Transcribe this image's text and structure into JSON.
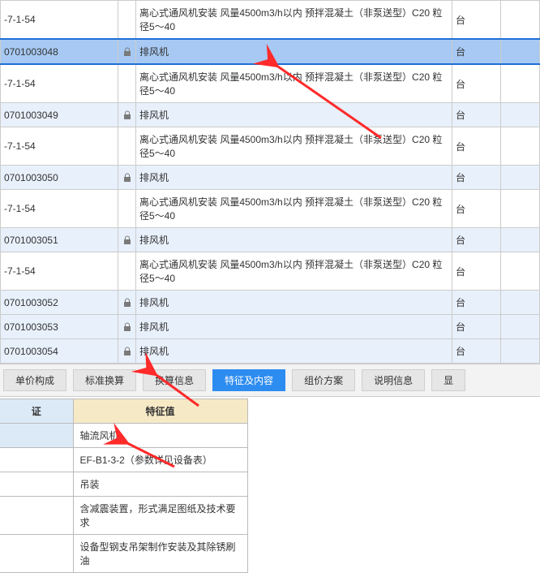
{
  "grid": {
    "rows": [
      {
        "code": "-7-1-54",
        "lock": false,
        "desc": "离心式通风机安装 风量4500m3/h以内 预拌混凝土（非泵送型）C20 粒径5～40",
        "unit": "台",
        "style": "white",
        "tall": true
      },
      {
        "code": "0701003048",
        "lock": true,
        "desc": "排风机",
        "unit": "台",
        "style": "selected"
      },
      {
        "code": "-7-1-54",
        "lock": false,
        "desc": "离心式通风机安装 风量4500m3/h以内 预拌混凝土（非泵送型）C20 粒径5～40",
        "unit": "台",
        "style": "white",
        "tall": true
      },
      {
        "code": "0701003049",
        "lock": true,
        "desc": "排风机",
        "unit": "台",
        "style": "blue"
      },
      {
        "code": "-7-1-54",
        "lock": false,
        "desc": "离心式通风机安装 风量4500m3/h以内 预拌混凝土（非泵送型）C20 粒径5～40",
        "unit": "台",
        "style": "white",
        "tall": true
      },
      {
        "code": "0701003050",
        "lock": true,
        "desc": "排风机",
        "unit": "台",
        "style": "blue"
      },
      {
        "code": "-7-1-54",
        "lock": false,
        "desc": "离心式通风机安装 风量4500m3/h以内 预拌混凝土（非泵送型）C20 粒径5～40",
        "unit": "台",
        "style": "white",
        "tall": true
      },
      {
        "code": "0701003051",
        "lock": true,
        "desc": "排风机",
        "unit": "台",
        "style": "blue"
      },
      {
        "code": "-7-1-54",
        "lock": false,
        "desc": "离心式通风机安装 风量4500m3/h以内 预拌混凝土（非泵送型）C20 粒径5～40",
        "unit": "台",
        "style": "white",
        "tall": true
      },
      {
        "code": "0701003052",
        "lock": true,
        "desc": "排风机",
        "unit": "台",
        "style": "blue"
      },
      {
        "code": "0701003053",
        "lock": true,
        "desc": "排风机",
        "unit": "台",
        "style": "blue"
      },
      {
        "code": "0701003054",
        "lock": true,
        "desc": "排风机",
        "unit": "台",
        "style": "blue"
      }
    ]
  },
  "tabs": {
    "items": [
      {
        "label": "单价构成",
        "active": false
      },
      {
        "label": "标准换算",
        "active": false
      },
      {
        "label": "换算信息",
        "active": false
      },
      {
        "label": "特征及内容",
        "active": true
      },
      {
        "label": "组价方案",
        "active": false
      },
      {
        "label": "说明信息",
        "active": false
      },
      {
        "label": "显",
        "active": false
      }
    ]
  },
  "detail": {
    "headers": {
      "left": "证",
      "value": "特征值"
    },
    "rows": [
      {
        "left": "",
        "value": "轴流风机"
      },
      {
        "left": "",
        "value": "EF-B1-3-2（参数详见设备表）"
      },
      {
        "left": "",
        "value": "吊装"
      },
      {
        "left": "",
        "value": "含减震装置，形式满足图纸及技术要求"
      },
      {
        "left": "",
        "value": "设备型钢支吊架制作安装及其除锈刷油"
      }
    ]
  },
  "colors": {
    "arrow": "#ff2a2a"
  }
}
